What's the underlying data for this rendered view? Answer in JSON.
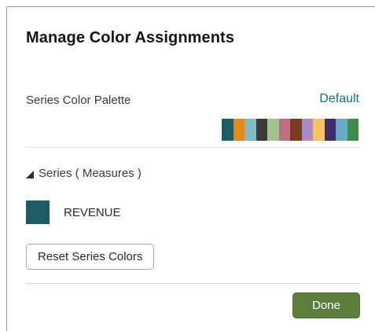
{
  "dialog": {
    "title": "Manage Color Assignments"
  },
  "palette": {
    "label": "Series Color Palette",
    "selected": "Default",
    "colors": [
      "#1f5d66",
      "#e58a1f",
      "#7fbcc0",
      "#3b3b3b",
      "#a4c48f",
      "#c06d86",
      "#7a3d1b",
      "#a98bc7",
      "#f5c26b",
      "#3c2d6b",
      "#6aa9c4",
      "#3e8c4a"
    ]
  },
  "series": {
    "header": "Series ( Measures )",
    "items": [
      {
        "name": "REVENUE",
        "color": "#1f5d66"
      }
    ]
  },
  "actions": {
    "reset_label": "Reset Series Colors",
    "done_label": "Done"
  }
}
